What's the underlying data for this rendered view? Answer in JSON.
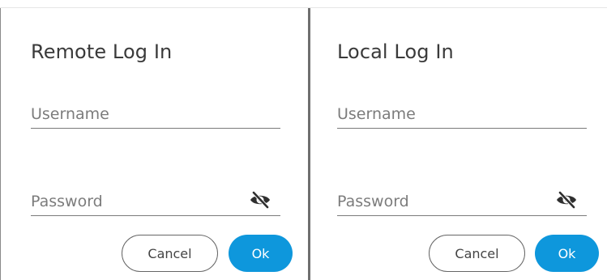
{
  "remote_dialog": {
    "title": "Remote Log In",
    "username_placeholder": "Username",
    "password_placeholder": "Password",
    "cancel_label": "Cancel",
    "ok_label": "Ok"
  },
  "local_dialog": {
    "title": "Local Log In",
    "username_placeholder": "Username",
    "password_placeholder": "Password",
    "cancel_label": "Cancel",
    "ok_label": "Ok"
  },
  "icons": {
    "password_toggle": "eye-slash-icon"
  },
  "colors": {
    "accent": "#0e97dc",
    "title_text": "#3a3a3a",
    "placeholder_text": "#7c7c7c",
    "divider": "#6f6f6f"
  }
}
